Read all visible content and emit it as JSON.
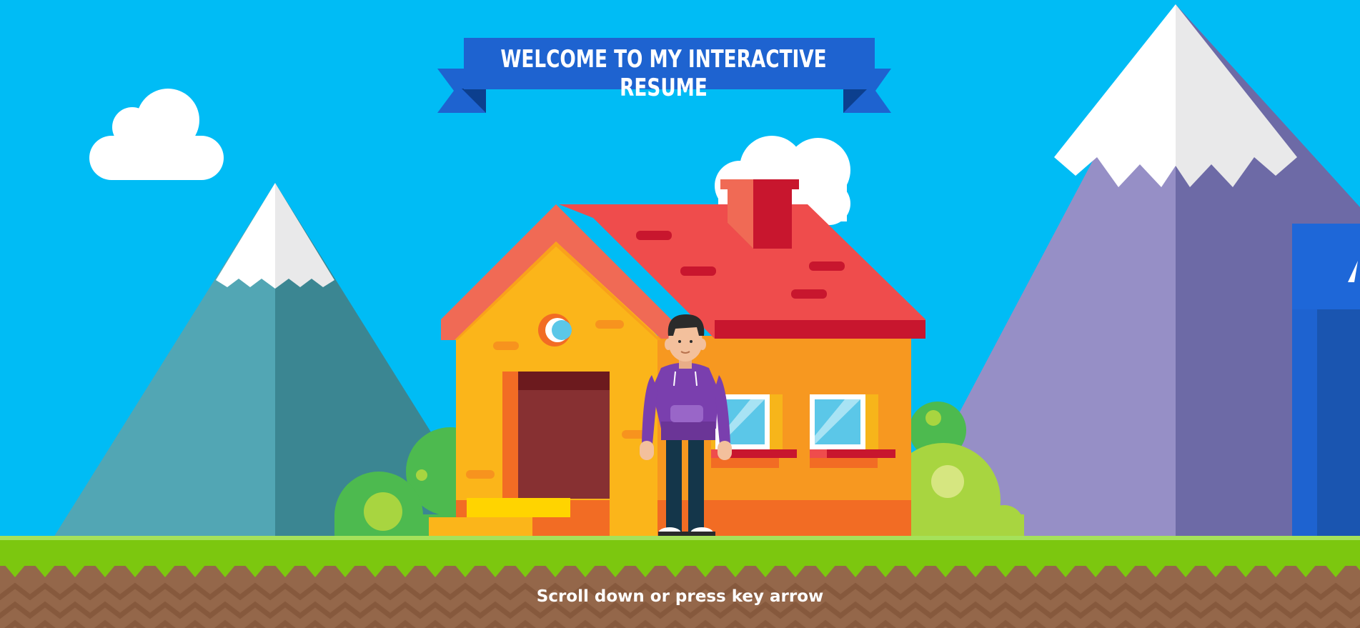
{
  "banner": {
    "title": "WELCOME TO MY INTERACTIVE RESUME"
  },
  "footer": {
    "hint": "Scroll down or press key arrow"
  },
  "colors": {
    "sky": "#00bcf5",
    "ribbon": "#1e63d0",
    "ribbon_dark": "#0c3f8e",
    "grass": "#7cc70f",
    "ground": "#94674a",
    "roof": "#ef4c4c",
    "wall": "#f9b51a",
    "hoodie": "#7a3fae"
  }
}
